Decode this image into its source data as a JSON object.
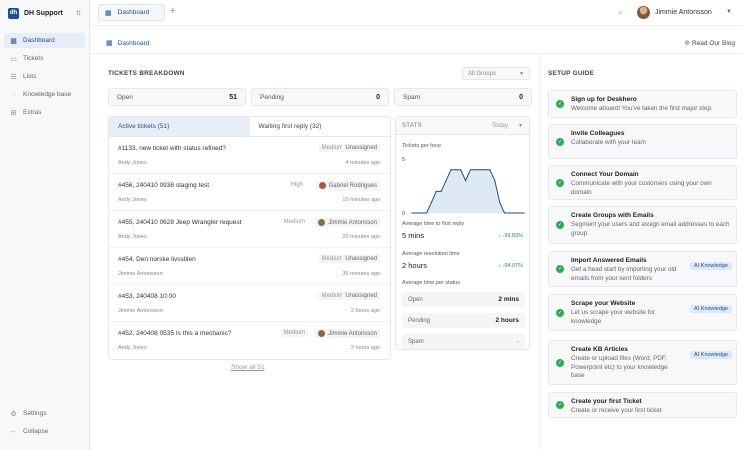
{
  "sidebar": {
    "brand": {
      "logo": "dh",
      "name": "DH Support"
    },
    "items": [
      {
        "label": "Dashboard",
        "icon": "grid-icon",
        "active": true
      },
      {
        "label": "Tickets",
        "icon": "ticket-icon"
      },
      {
        "label": "Lists",
        "icon": "list-icon"
      },
      {
        "label": "Knowledge base",
        "icon": "bulb-icon"
      },
      {
        "label": "Extras",
        "icon": "extras-icon"
      }
    ],
    "bottom": [
      {
        "label": "Settings",
        "icon": "gear-icon"
      },
      {
        "label": "Collapse",
        "icon": "arrow-left-icon"
      }
    ]
  },
  "topbar": {
    "tab_label": "Dashboard",
    "user_name": "Jimmie Antonsson"
  },
  "subheader": {
    "breadcrumb": "Dashboard",
    "blog_link": "Read Our Blog"
  },
  "breakdown": {
    "title": "TICKETS BREAKDOWN",
    "group_select": "All Groups",
    "stats": [
      {
        "label": "Open",
        "value": "51"
      },
      {
        "label": "Pending",
        "value": "0"
      },
      {
        "label": "Spam",
        "value": "0"
      }
    ]
  },
  "ticket_list": {
    "tabs": [
      "Active tickets (51)",
      "Waiting first reply (32)"
    ],
    "tickets": [
      {
        "title": "#1133, new ticket with status refined?",
        "agent": "Andy Jones",
        "priority": "Medium",
        "assignee": "Unassigned",
        "time": "4 minutes ago"
      },
      {
        "title": "#456, 240410 0938 staging test",
        "agent": "Andy Jones",
        "priority": "High",
        "assignee": "Gabriel Rodrigues",
        "time": "10 minutes ago"
      },
      {
        "title": "#455, 240410 0628 Jeep Wrangler request",
        "agent": "Andy Jones",
        "priority": "Medium",
        "assignee": "Jimmie Antonsson",
        "time": "20 minutes ago"
      },
      {
        "title": "#454, Den norske livsstilen",
        "agent": "Jimmie Antonsson",
        "priority": "Medium",
        "assignee": "Unassigned",
        "time": "36 minutes ago"
      },
      {
        "title": "#453, 240408 10:00",
        "agent": "Jimmie Antonsson",
        "priority": "Medium",
        "assignee": "Unassigned",
        "time": "2 hours ago"
      },
      {
        "title": "#452, 240408 0535 Is this a mechanic?",
        "agent": "Andy Jones",
        "priority": "Medium",
        "assignee": "Jimmie Antonsson",
        "time": "2 hours ago"
      }
    ],
    "show_all": "Show all 51"
  },
  "stats_panel": {
    "title": "STATS",
    "period": "Today",
    "chart_label": "Tickets per hour",
    "first_reply_label": "Average time to first reply",
    "first_reply_value": "5 mins",
    "first_reply_delta": "↓ -99.83%",
    "resolution_label": "Average resolution time",
    "resolution_value": "2 hours",
    "resolution_delta": "↓ -94.07%",
    "per_status_label": "Average time per status",
    "per_status": [
      {
        "label": "Open",
        "value": "2 mins"
      },
      {
        "label": "Pending",
        "value": "2 hours"
      },
      {
        "label": "Spam",
        "value": "-"
      }
    ]
  },
  "chart_data": {
    "type": "area",
    "title": "Tickets per hour",
    "ylim": [
      0,
      5
    ],
    "yticks": [
      "5",
      "0"
    ],
    "x": [
      0,
      1,
      2,
      3,
      4,
      5,
      6,
      7,
      8,
      9,
      10,
      11,
      12,
      13,
      14,
      15,
      16,
      17,
      18,
      19,
      20,
      21,
      22,
      23
    ],
    "values": [
      0,
      0,
      0,
      0,
      1,
      2,
      2,
      3,
      4,
      4,
      4,
      3,
      4,
      4,
      4,
      4,
      4,
      3,
      1,
      0,
      0,
      0,
      0,
      0
    ],
    "color": "#1d4f91",
    "fill": "#dfe8f5"
  },
  "setup": {
    "title": "SETUP GUIDE",
    "items": [
      {
        "title": "Sign up for Deskhero",
        "desc": [
          "Welcome aboard! You've taken the first major step."
        ],
        "badge": ""
      },
      {
        "title": "Invite Colleagues",
        "desc": [
          "Collaborate with your team"
        ],
        "badge": ""
      },
      {
        "title": "Connect Your Domain",
        "desc": [
          "Communicate with your customers using your own",
          "domain"
        ],
        "badge": ""
      },
      {
        "title": "Create Groups with Emails",
        "desc": [
          "Segment your users and assign email addresses to each",
          "group"
        ],
        "badge": ""
      },
      {
        "title": "Import Answered Emails",
        "desc": [
          "Get a head start by importing your old",
          "emails from your sent folders"
        ],
        "badge": "AI Knowledge"
      },
      {
        "title": "Scrape your Website",
        "desc": [
          "Let us scrape your website for",
          "knowledge"
        ],
        "badge": "AI Knowledge"
      },
      {
        "title": "Create KB Articles",
        "desc": [
          "Create or upload files (Word, PDF,",
          "Powerpoint etc) to your knowledge",
          "base"
        ],
        "badge": "AI Knowledge"
      },
      {
        "title": "Create your first Ticket",
        "desc": [
          "Create or receive your first ticket"
        ],
        "badge": ""
      }
    ]
  }
}
